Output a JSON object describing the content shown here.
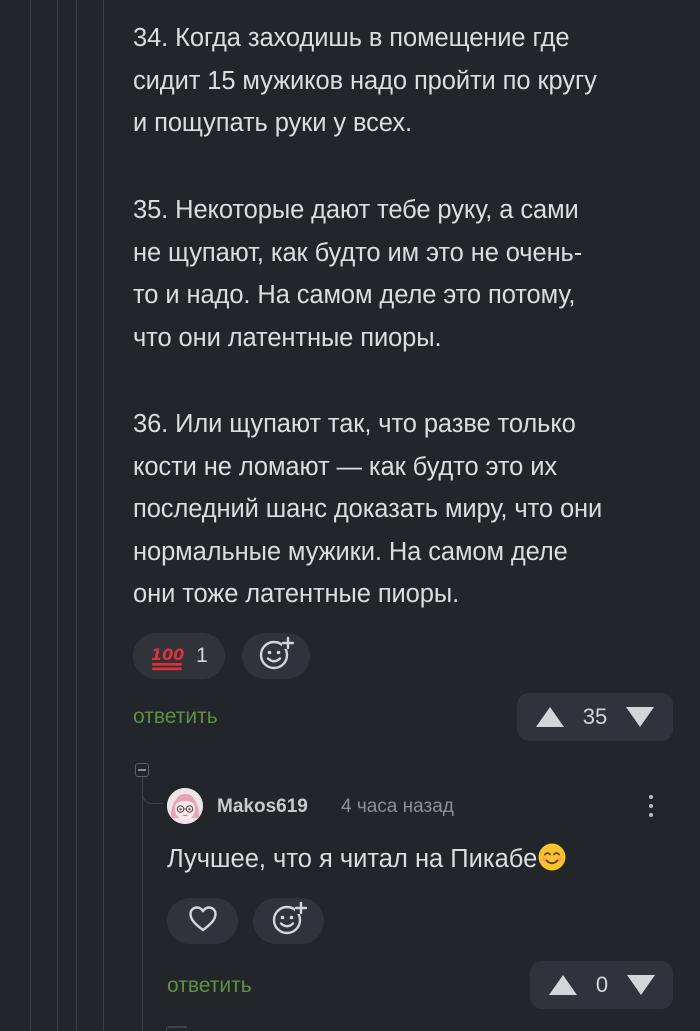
{
  "comment": {
    "paragraphs": [
      "34. Когда заходишь в помещение где\nсидит 15 мужиков надо пройти по кругу\nи пощупать руки у всех.",
      "35. Некоторые дают тебе руку, а сами\nне щупают, как будто им это не очень-\nто и надо. На самом деле это потому,\nчто они латентные пиоры.",
      "36. Или щупают так, что разве только\nкости не ломают — как будто это их\nпоследний шанс доказать миру, что они\nнормальные мужики. На самом деле\nони тоже латентные пиоры."
    ],
    "reaction": {
      "emoji": "💯",
      "count": "1"
    },
    "add_reaction_icon": "add-emoji-icon",
    "reply_label": "ответить",
    "rating": "35"
  },
  "reply": {
    "username": "Makos619",
    "time": "4 часа назад",
    "text": "Лучшее, что я читал на Пикабе",
    "text_emoji": "smiling-face",
    "like_icon": "heart-icon",
    "add_reaction_icon": "add-emoji-icon",
    "reply_label": "ответить",
    "rating": "0"
  },
  "colors": {
    "background": "#222529",
    "surface": "#30343a",
    "text": "#dcdde0",
    "accent_green": "#5d9140",
    "reaction_red": "#e0313a"
  }
}
